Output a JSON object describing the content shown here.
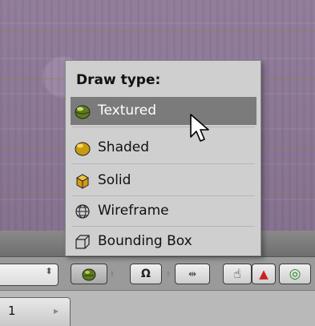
{
  "menu": {
    "title": "Draw type:",
    "items": [
      {
        "label": "Textured",
        "icon": "textured-icon",
        "active": true
      },
      {
        "label": "Shaded",
        "icon": "shaded-icon",
        "active": false
      },
      {
        "label": "Solid",
        "icon": "solid-icon",
        "active": false
      },
      {
        "label": "Wireframe",
        "icon": "wireframe-icon",
        "active": false
      },
      {
        "label": "Bounding Box",
        "icon": "bounding-box-icon",
        "active": false
      }
    ]
  },
  "statusbar": {
    "page_value": "1"
  },
  "colors": {
    "menu_bg": "#cfcfcf",
    "menu_active": "#7b7b7b",
    "viewport": "#8c7797"
  }
}
